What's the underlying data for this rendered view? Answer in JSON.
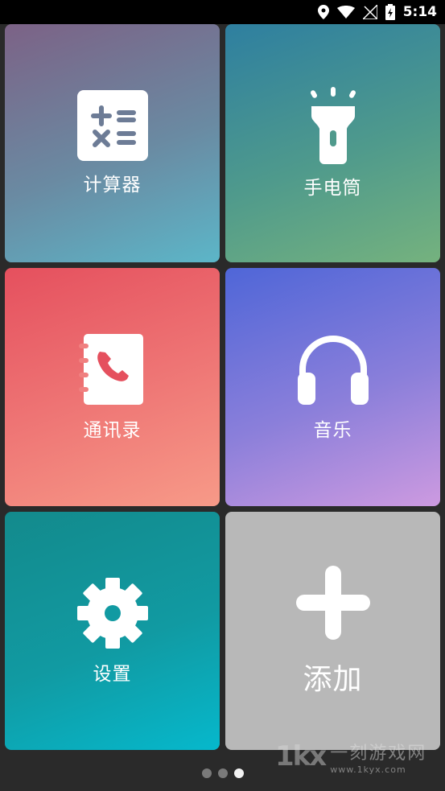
{
  "status_bar": {
    "time": "5:14",
    "icons": [
      "location-icon",
      "wifi-icon",
      "signal-icon",
      "battery-charging-icon"
    ]
  },
  "tiles": [
    {
      "label": "计算器",
      "icon": "calculator-icon",
      "color": "#6a8aa2"
    },
    {
      "label": "手电筒",
      "icon": "flashlight-icon",
      "color": "#4f9a8c"
    },
    {
      "label": "通讯录",
      "icon": "contacts-icon",
      "color": "#ee7474"
    },
    {
      "label": "音乐",
      "icon": "headphones-icon",
      "color": "#8b7fda"
    },
    {
      "label": "设置",
      "icon": "gear-icon",
      "color": "#119aa2"
    },
    {
      "label": "添加",
      "icon": "plus-icon",
      "color": "#b8b8b8"
    }
  ],
  "pager": {
    "pages": 3,
    "current": 3
  },
  "watermark": {
    "logo": "1kx",
    "name": "一刻游戏网",
    "url": "www.1kyx.com"
  }
}
